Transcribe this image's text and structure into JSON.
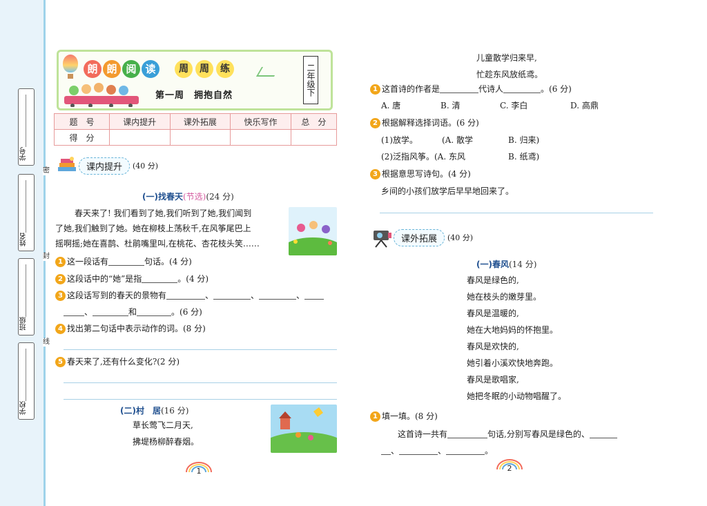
{
  "binding": {
    "fields": [
      "学号",
      "姓名",
      "班级",
      "学校"
    ],
    "seal_marks": [
      "密",
      "封",
      "线"
    ]
  },
  "header": {
    "logo_chars": [
      "朗",
      "朗",
      "阅",
      "读"
    ],
    "weekly_chars": [
      "周",
      "周",
      "练"
    ],
    "grade": "二年级下",
    "week_title": "第一周　拥抱自然"
  },
  "score_table": {
    "row1": [
      "题　号",
      "课内提升",
      "课外拓展",
      "快乐写作",
      "总　分"
    ],
    "row2": [
      "得　分",
      "",
      "",
      "",
      ""
    ]
  },
  "left": {
    "section_label": "课内提升",
    "section_points": "(40 分)",
    "part1": {
      "title": "(一)找春天",
      "note": "(节选)",
      "points": "(24 分)",
      "passage": [
        "　　春天来了! 我们看到了她,我们听到了她,我们闻到",
        "了她,我们触到了她。她在柳枝上荡秋千,在风筝尾巴上",
        "摇啊摇;她在喜鹊、杜鹃嘴里叫,在桃花、杏花枝头笑……"
      ],
      "q1_pre": "这一段话有",
      "q1_post": "句话。(4 分)",
      "q2_pre": "这段话中的“她”是指",
      "q2_post": "。(4 分)",
      "q3_pre": "这段话写到的春天的景物有",
      "q3_sep": "、",
      "q3_and": "和",
      "q3_post": "。(6 分)",
      "q4": "找出第二句话中表示动作的词。(8 分)",
      "q5": "春天来了,还有什么变化?(2 分)"
    },
    "part2": {
      "title": "(二)村　居",
      "points": "(16 分)",
      "lines": [
        "草长莺飞二月天,",
        "拂堤杨柳醉春烟。"
      ]
    },
    "page": "1"
  },
  "right": {
    "poem_tail": [
      "儿童散学归来早,",
      "忙趁东风放纸鸢。"
    ],
    "q1_pre": "这首诗的作者是",
    "q1_mid": "代诗人",
    "q1_post": "。(6 分)",
    "q1_options": [
      "A. 唐",
      "B. 清",
      "C. 李白",
      "D. 高鼎"
    ],
    "q2": "根据解释选择词语。(6 分)",
    "q2_items": [
      [
        "(1)放学。",
        "(A. 散学",
        "B. 归来)"
      ],
      [
        "(2)泛指风筝。(A. 东风",
        "",
        "B. 纸鸢)"
      ]
    ],
    "q3": "根据意思写诗句。(4 分)",
    "q3_text": "乡间的小孩们放学后早早地回来了。",
    "section_label": "课外拓展",
    "section_points": "(40 分)",
    "part1": {
      "title": "(一)春风",
      "points": "(14 分)",
      "lines": [
        "春风是绿色的,",
        "她在枝头的嫩芽里。",
        "春风是温暖的,",
        "她在大地妈妈的怀抱里。",
        "春风是欢快的,",
        "她引着小溪欢快地奔跑。",
        "春风是歌唱家,",
        "她把冬眠的小动物唱醒了。"
      ],
      "q1": "填一填。(8 分)",
      "q1_text_pre": "　　这首诗一共有",
      "q1_text_mid": "句话,分别写春风是绿色的、",
      "q1_sep": "、",
      "q1_end": "。"
    },
    "page": "2"
  },
  "colors": {
    "accent_blue": "#1f4f8f",
    "number_badge": "#f2a61a",
    "table_border": "#e79a9a",
    "banner_border": "#bfe39a"
  }
}
